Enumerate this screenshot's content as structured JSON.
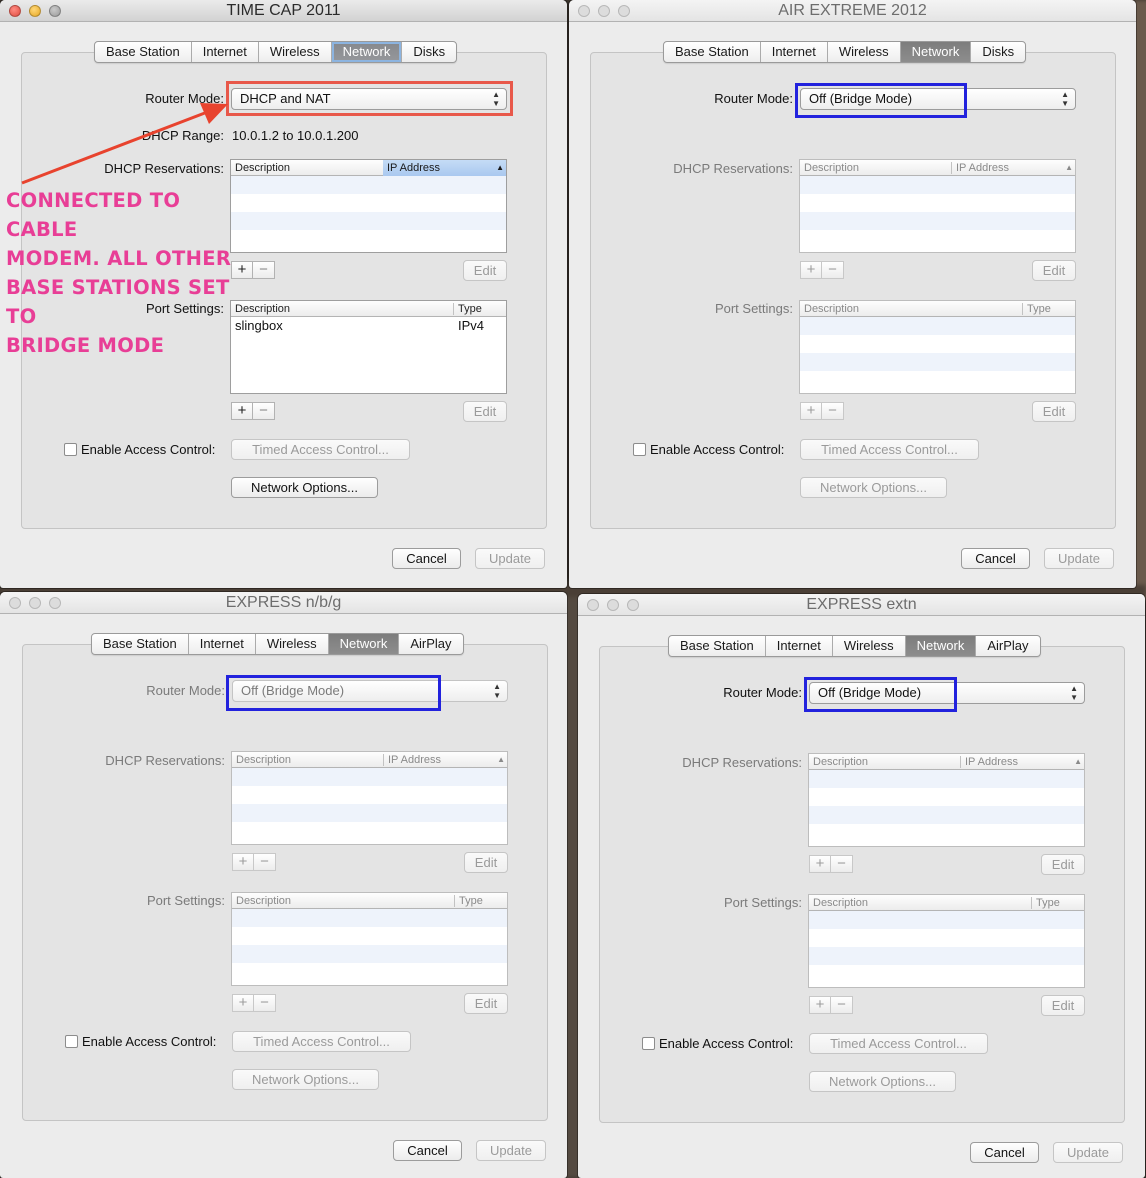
{
  "tabs_labels": {
    "base": "Base Station",
    "internet": "Internet",
    "wireless": "Wireless",
    "network": "Network",
    "disks": "Disks",
    "airplay": "AirPlay"
  },
  "labels": {
    "router_mode": "Router Mode:",
    "dhcp_range": "DHCP Range:",
    "dhcp_reservations": "DHCP Reservations:",
    "port_settings": "Port Settings:",
    "enable_access_control": "Enable Access Control:",
    "timed_access_control": "Timed Access Control...",
    "network_options": "Network Options...",
    "edit": "Edit",
    "cancel": "Cancel",
    "update": "Update",
    "col_description": "Description",
    "col_ip_address": "IP Address",
    "col_type": "Type",
    "plus": "+",
    "minus": "−"
  },
  "windows": [
    {
      "title": "TIME CAP 2011",
      "router_mode": "DHCP and NAT",
      "dhcp_range": "10.0.1.2 to 10.0.1.200",
      "port_rows": [
        {
          "description": "slingbox",
          "type": "IPv4"
        }
      ]
    },
    {
      "title": "AIR EXTREME 2012",
      "router_mode": "Off (Bridge Mode)"
    },
    {
      "title": "EXPRESS n/b/g",
      "router_mode": "Off (Bridge Mode)"
    },
    {
      "title": "EXPRESS extn",
      "router_mode": "Off (Bridge Mode)"
    }
  ],
  "annotation": {
    "lines": [
      "CONNECTED TO CABLE",
      "MODEM. ALL OTHER",
      "BASE STATIONS SET TO",
      "BRIDGE MODE"
    ]
  },
  "colors": {
    "annotation": "#e83e96",
    "highlight_red": "#e8584a",
    "highlight_blue": "#2222dd",
    "arrow": "#e8432e"
  }
}
